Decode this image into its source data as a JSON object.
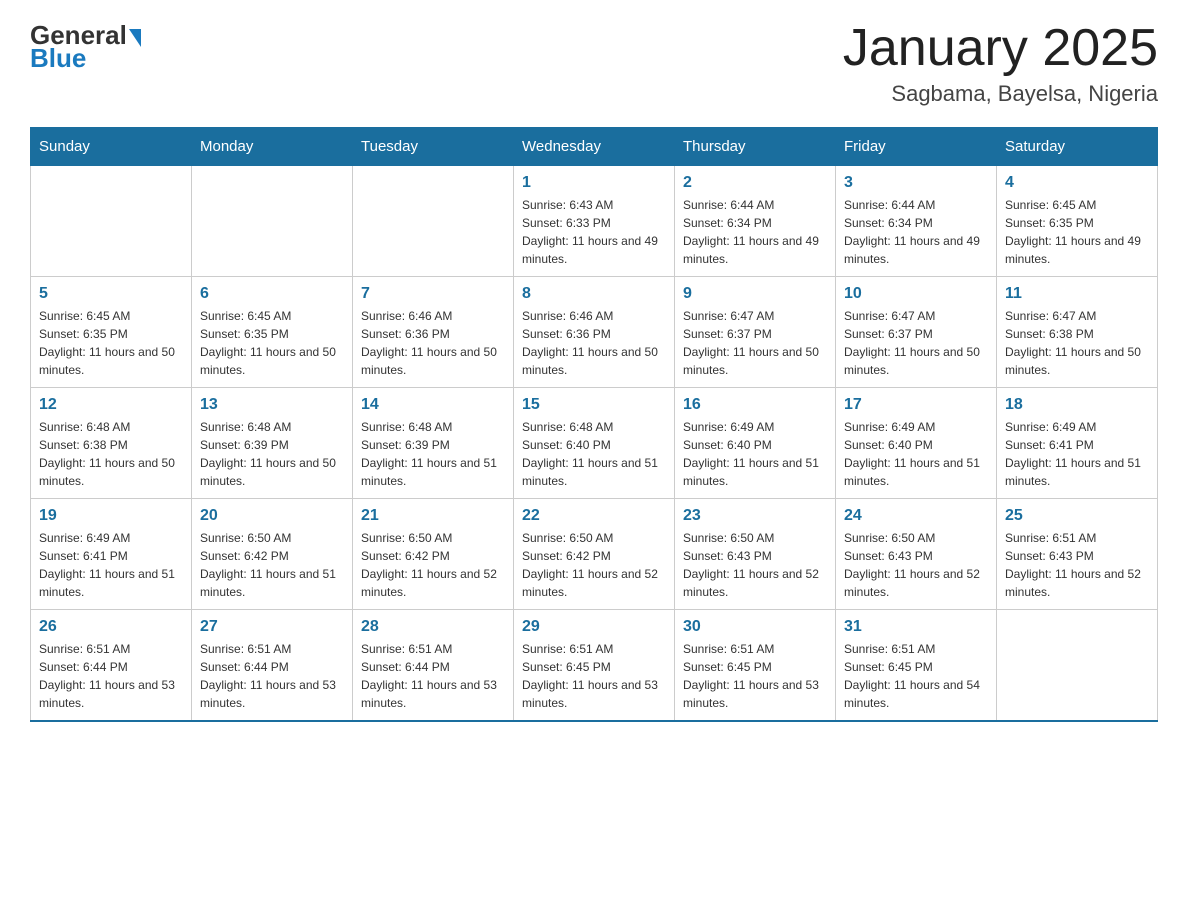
{
  "logo": {
    "general": "General",
    "blue": "Blue"
  },
  "header": {
    "title": "January 2025",
    "subtitle": "Sagbama, Bayelsa, Nigeria"
  },
  "days_of_week": [
    "Sunday",
    "Monday",
    "Tuesday",
    "Wednesday",
    "Thursday",
    "Friday",
    "Saturday"
  ],
  "weeks": [
    [
      {
        "day": "",
        "info": ""
      },
      {
        "day": "",
        "info": ""
      },
      {
        "day": "",
        "info": ""
      },
      {
        "day": "1",
        "info": "Sunrise: 6:43 AM\nSunset: 6:33 PM\nDaylight: 11 hours and 49 minutes."
      },
      {
        "day": "2",
        "info": "Sunrise: 6:44 AM\nSunset: 6:34 PM\nDaylight: 11 hours and 49 minutes."
      },
      {
        "day": "3",
        "info": "Sunrise: 6:44 AM\nSunset: 6:34 PM\nDaylight: 11 hours and 49 minutes."
      },
      {
        "day": "4",
        "info": "Sunrise: 6:45 AM\nSunset: 6:35 PM\nDaylight: 11 hours and 49 minutes."
      }
    ],
    [
      {
        "day": "5",
        "info": "Sunrise: 6:45 AM\nSunset: 6:35 PM\nDaylight: 11 hours and 50 minutes."
      },
      {
        "day": "6",
        "info": "Sunrise: 6:45 AM\nSunset: 6:35 PM\nDaylight: 11 hours and 50 minutes."
      },
      {
        "day": "7",
        "info": "Sunrise: 6:46 AM\nSunset: 6:36 PM\nDaylight: 11 hours and 50 minutes."
      },
      {
        "day": "8",
        "info": "Sunrise: 6:46 AM\nSunset: 6:36 PM\nDaylight: 11 hours and 50 minutes."
      },
      {
        "day": "9",
        "info": "Sunrise: 6:47 AM\nSunset: 6:37 PM\nDaylight: 11 hours and 50 minutes."
      },
      {
        "day": "10",
        "info": "Sunrise: 6:47 AM\nSunset: 6:37 PM\nDaylight: 11 hours and 50 minutes."
      },
      {
        "day": "11",
        "info": "Sunrise: 6:47 AM\nSunset: 6:38 PM\nDaylight: 11 hours and 50 minutes."
      }
    ],
    [
      {
        "day": "12",
        "info": "Sunrise: 6:48 AM\nSunset: 6:38 PM\nDaylight: 11 hours and 50 minutes."
      },
      {
        "day": "13",
        "info": "Sunrise: 6:48 AM\nSunset: 6:39 PM\nDaylight: 11 hours and 50 minutes."
      },
      {
        "day": "14",
        "info": "Sunrise: 6:48 AM\nSunset: 6:39 PM\nDaylight: 11 hours and 51 minutes."
      },
      {
        "day": "15",
        "info": "Sunrise: 6:48 AM\nSunset: 6:40 PM\nDaylight: 11 hours and 51 minutes."
      },
      {
        "day": "16",
        "info": "Sunrise: 6:49 AM\nSunset: 6:40 PM\nDaylight: 11 hours and 51 minutes."
      },
      {
        "day": "17",
        "info": "Sunrise: 6:49 AM\nSunset: 6:40 PM\nDaylight: 11 hours and 51 minutes."
      },
      {
        "day": "18",
        "info": "Sunrise: 6:49 AM\nSunset: 6:41 PM\nDaylight: 11 hours and 51 minutes."
      }
    ],
    [
      {
        "day": "19",
        "info": "Sunrise: 6:49 AM\nSunset: 6:41 PM\nDaylight: 11 hours and 51 minutes."
      },
      {
        "day": "20",
        "info": "Sunrise: 6:50 AM\nSunset: 6:42 PM\nDaylight: 11 hours and 51 minutes."
      },
      {
        "day": "21",
        "info": "Sunrise: 6:50 AM\nSunset: 6:42 PM\nDaylight: 11 hours and 52 minutes."
      },
      {
        "day": "22",
        "info": "Sunrise: 6:50 AM\nSunset: 6:42 PM\nDaylight: 11 hours and 52 minutes."
      },
      {
        "day": "23",
        "info": "Sunrise: 6:50 AM\nSunset: 6:43 PM\nDaylight: 11 hours and 52 minutes."
      },
      {
        "day": "24",
        "info": "Sunrise: 6:50 AM\nSunset: 6:43 PM\nDaylight: 11 hours and 52 minutes."
      },
      {
        "day": "25",
        "info": "Sunrise: 6:51 AM\nSunset: 6:43 PM\nDaylight: 11 hours and 52 minutes."
      }
    ],
    [
      {
        "day": "26",
        "info": "Sunrise: 6:51 AM\nSunset: 6:44 PM\nDaylight: 11 hours and 53 minutes."
      },
      {
        "day": "27",
        "info": "Sunrise: 6:51 AM\nSunset: 6:44 PM\nDaylight: 11 hours and 53 minutes."
      },
      {
        "day": "28",
        "info": "Sunrise: 6:51 AM\nSunset: 6:44 PM\nDaylight: 11 hours and 53 minutes."
      },
      {
        "day": "29",
        "info": "Sunrise: 6:51 AM\nSunset: 6:45 PM\nDaylight: 11 hours and 53 minutes."
      },
      {
        "day": "30",
        "info": "Sunrise: 6:51 AM\nSunset: 6:45 PM\nDaylight: 11 hours and 53 minutes."
      },
      {
        "day": "31",
        "info": "Sunrise: 6:51 AM\nSunset: 6:45 PM\nDaylight: 11 hours and 54 minutes."
      },
      {
        "day": "",
        "info": ""
      }
    ]
  ]
}
